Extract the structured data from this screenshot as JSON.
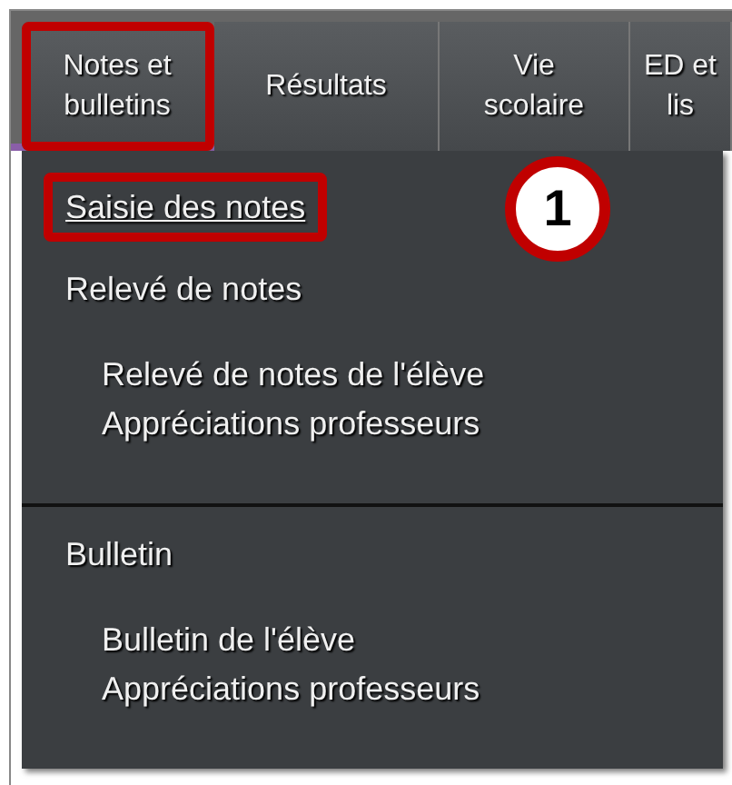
{
  "tabs": [
    {
      "label": "Notes et bulletins",
      "highlighted": true
    },
    {
      "label": "Résultats",
      "highlighted": false
    },
    {
      "label": "Vie scolaire",
      "highlighted": false
    },
    {
      "label": "ED et lis",
      "highlighted": false
    }
  ],
  "callout": "1",
  "menu": {
    "sections": [
      {
        "items": [
          {
            "label": "Saisie des notes",
            "highlighted": true,
            "kind": "link"
          },
          {
            "label": "Relevé de notes",
            "highlighted": false,
            "kind": "heading",
            "children": [
              {
                "label": "Relevé de notes de l'élève"
              },
              {
                "label": "Appréciations professeurs"
              }
            ]
          }
        ]
      },
      {
        "items": [
          {
            "label": "Bulletin",
            "highlighted": false,
            "kind": "heading",
            "children": [
              {
                "label": "Bulletin de l'élève"
              },
              {
                "label": "Appréciations professeurs"
              }
            ]
          }
        ]
      }
    ]
  }
}
